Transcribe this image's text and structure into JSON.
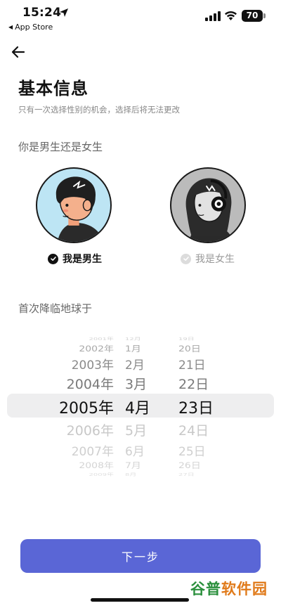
{
  "status_bar": {
    "time": "15:24",
    "back_app_label": "App Store",
    "battery": "70"
  },
  "header": {
    "title": "基本信息",
    "subtitle": "只有一次选择性别的机会，选择后将无法更改"
  },
  "gender": {
    "section_label": "你是男生还是女生",
    "options": [
      {
        "label": "我是男生",
        "selected": true
      },
      {
        "label": "我是女生",
        "selected": false
      }
    ]
  },
  "birth": {
    "section_label": "首次降临地球于",
    "years": [
      "2001年",
      "2002年",
      "2003年",
      "2004年",
      "2005年",
      "2006年",
      "2007年",
      "2008年",
      "2009年"
    ],
    "months": [
      "12月",
      "1月",
      "2月",
      "3月",
      "4月",
      "5月",
      "6月",
      "7月",
      "8月"
    ],
    "days": [
      "19日",
      "20日",
      "21日",
      "22日",
      "23日",
      "24日",
      "25日",
      "26日",
      "27日"
    ],
    "selected": {
      "year": "2005年",
      "month": "4月",
      "day": "23日"
    }
  },
  "next_button_label": "下一步",
  "watermark": {
    "part1": "谷普",
    "part2": "软件园"
  },
  "colors": {
    "accent": "#5a66d6",
    "male_bg": "#bde5f4",
    "female_bg": "#bbbbbb"
  }
}
